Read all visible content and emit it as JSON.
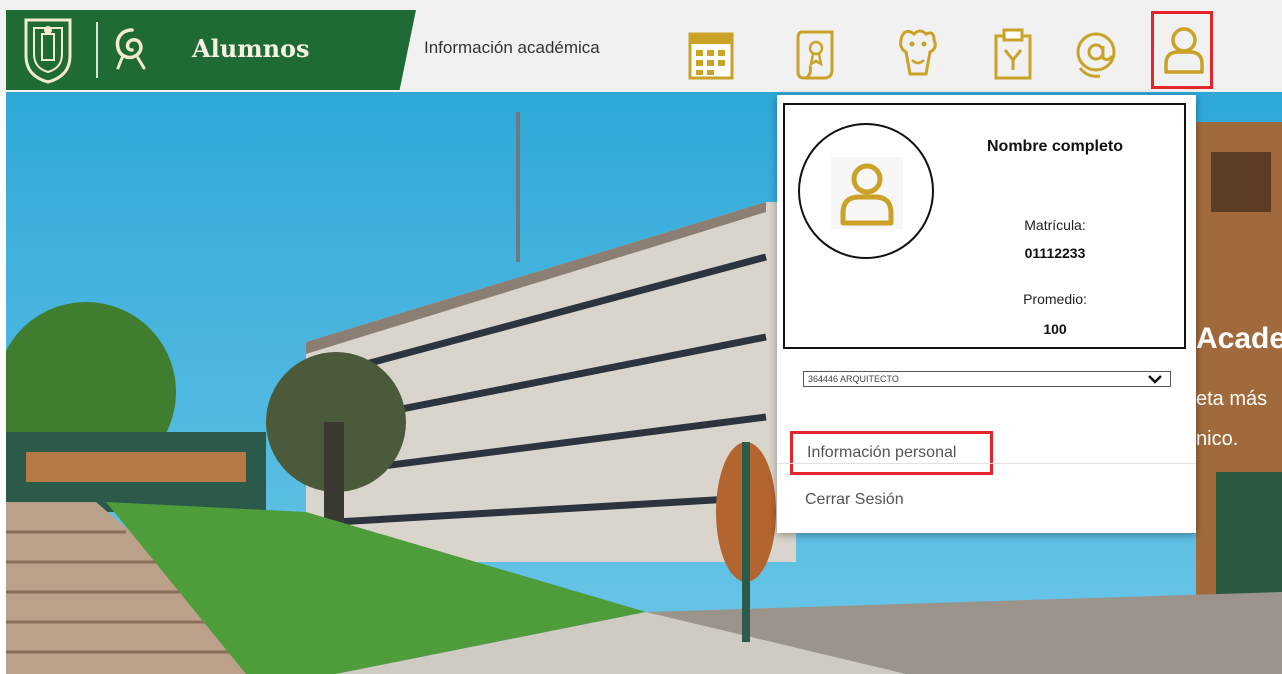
{
  "header": {
    "brand_title": "Alumnos",
    "nav_link": "Información académica",
    "icons": [
      "calendar-icon",
      "diploma-icon",
      "mascot-icon",
      "clipboard-icon",
      "email-icon",
      "user-icon"
    ]
  },
  "hero": {
    "heading": "Acade",
    "line1": "eta más",
    "line2": "nico."
  },
  "profile": {
    "full_name": "Nombre completo",
    "matricula_label": "Matrícula:",
    "matricula_value": "01112233",
    "promedio_label": "Promedio:",
    "promedio_value": "100",
    "career_select": "364446   ARQUITECTO",
    "menu_personal": "Información personal",
    "menu_logout": "Cerrar Sesión"
  },
  "colors": {
    "brand_green": "#1f6b35",
    "icon_gold": "#c9a227",
    "highlight_red": "#e52529"
  }
}
